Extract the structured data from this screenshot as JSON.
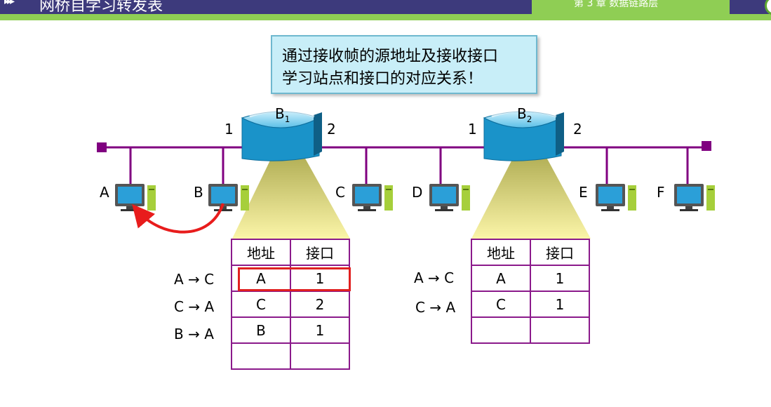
{
  "header": {
    "title": "网桥自学习转发表",
    "chapter": "第 3 章 数据链路层",
    "colors": {
      "bar": "#3d3a7c",
      "accent": "#8fce54"
    }
  },
  "callout": {
    "line1": "通过接收帧的源地址及接收接口",
    "line2": "学习站点和接口的对应关系！"
  },
  "bridges": [
    {
      "name": "B",
      "sub": "1",
      "port_left": "1",
      "port_right": "2"
    },
    {
      "name": "B",
      "sub": "2",
      "port_left": "1",
      "port_right": "2"
    }
  ],
  "hosts": [
    "A",
    "B",
    "C",
    "D",
    "E",
    "F"
  ],
  "table1": {
    "headers": [
      "地址",
      "接口"
    ],
    "row_labels": [
      "A → C",
      "C → A",
      "B → A"
    ],
    "rows": [
      [
        "A",
        "1"
      ],
      [
        "C",
        "2"
      ],
      [
        "B",
        "1"
      ],
      [
        "",
        ""
      ]
    ]
  },
  "table2": {
    "headers": [
      "地址",
      "接口"
    ],
    "row_labels": [
      "A → C",
      "C → A"
    ],
    "rows": [
      [
        "A",
        "1"
      ],
      [
        "C",
        "1"
      ],
      [
        "",
        ""
      ]
    ]
  }
}
